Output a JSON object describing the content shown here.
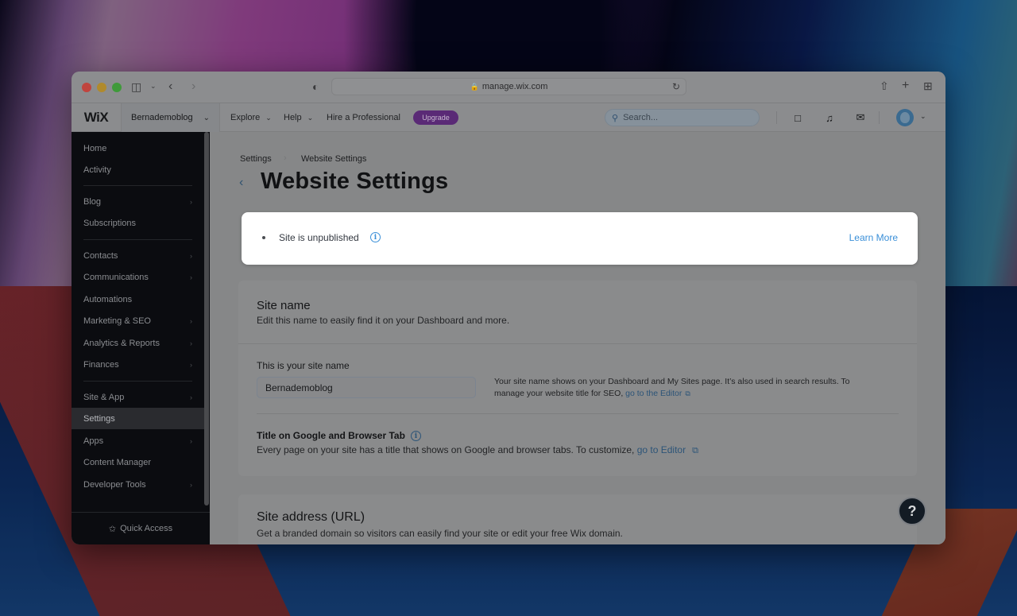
{
  "browser": {
    "url": "manage.wix.com"
  },
  "appbar": {
    "logo": "WiX",
    "site_name": "Bernademoblog",
    "nav": [
      {
        "label": "Explore",
        "has_dropdown": true
      },
      {
        "label": "Help",
        "has_dropdown": true
      },
      {
        "label": "Hire a Professional",
        "has_dropdown": false
      }
    ],
    "upgrade_label": "Upgrade",
    "search_placeholder": "Search...",
    "icons": [
      "chat-icon",
      "bell-icon",
      "megaphone-icon"
    ],
    "accent_upgrade": "#5a2a76"
  },
  "sidebar": {
    "items": [
      {
        "label": "Home",
        "chevron": false
      },
      {
        "label": "Activity",
        "chevron": false
      },
      {
        "label": "Blog",
        "chevron": true
      },
      {
        "label": "Subscriptions",
        "chevron": false
      },
      {
        "label": "Contacts",
        "chevron": true
      },
      {
        "label": "Communications",
        "chevron": true
      },
      {
        "label": "Automations",
        "chevron": false
      },
      {
        "label": "Marketing & SEO",
        "chevron": true
      },
      {
        "label": "Analytics & Reports",
        "chevron": true
      },
      {
        "label": "Finances",
        "chevron": true
      },
      {
        "label": "Site & App",
        "chevron": true
      },
      {
        "label": "Settings",
        "chevron": false,
        "active": true
      },
      {
        "label": "Apps",
        "chevron": true
      },
      {
        "label": "Content Manager",
        "chevron": false
      },
      {
        "label": "Developer Tools",
        "chevron": true
      }
    ],
    "quick_access": "Quick Access"
  },
  "main": {
    "breadcrumb": [
      "Settings",
      "Website Settings"
    ],
    "title": "Website Settings",
    "banner": {
      "status": "Site is unpublished",
      "learn_more": "Learn More"
    },
    "site_name_card": {
      "title": "Site name",
      "subtitle": "Edit this name to easily find it on your Dashboard and more.",
      "field_label": "This is your site name",
      "field_value": "Bernademoblog",
      "help_text": "Your site name shows on your Dashboard and My Sites page. It’s also used in search results. To manage your website title for SEO, ",
      "help_link": "go to the Editor",
      "google_title": "Title on Google and Browser Tab",
      "google_desc": "Every page on your site has a title that shows on Google and browser tabs. To customize, ",
      "google_link": "go to Editor"
    },
    "site_address_card": {
      "title": "Site address (URL)",
      "subtitle": "Get a branded domain so visitors can easily find your site or edit your free Wix domain."
    }
  },
  "help_button": "?"
}
